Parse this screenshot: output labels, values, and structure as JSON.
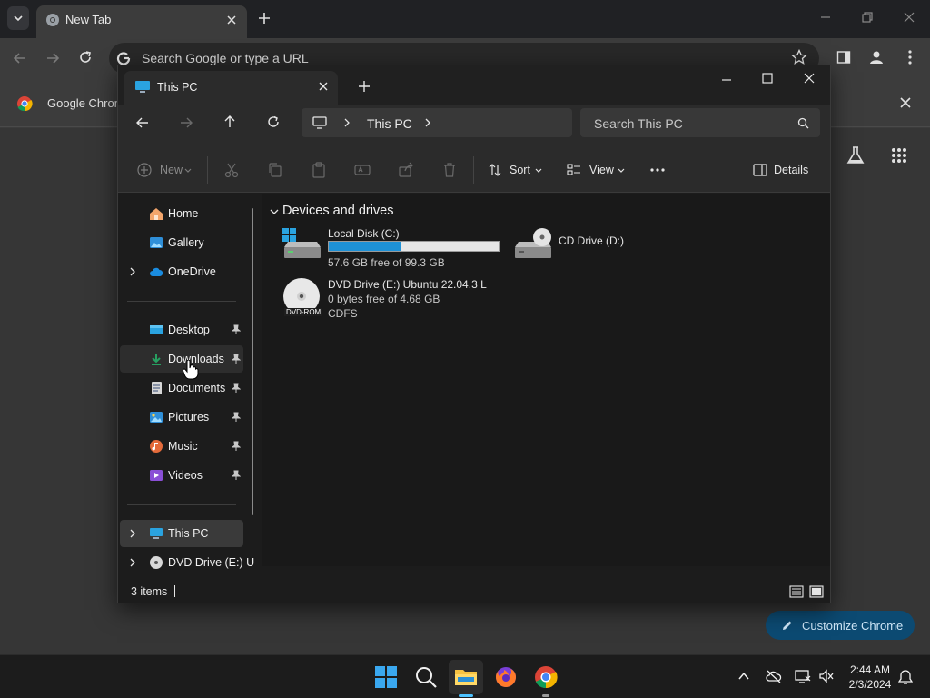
{
  "chrome": {
    "tab_title": "New Tab",
    "omnibox_placeholder": "Search Google or type a URL",
    "bookmark_label": "Google Chrome",
    "customize_label": "Customize Chrome"
  },
  "explorer": {
    "tab_title": "This PC",
    "breadcrumb": "This PC",
    "search_placeholder": "Search This PC",
    "commands": {
      "new": "New",
      "sort": "Sort",
      "view": "View",
      "details": "Details"
    },
    "sidebar": {
      "home": "Home",
      "gallery": "Gallery",
      "onedrive": "OneDrive",
      "desktop": "Desktop",
      "downloads": "Downloads",
      "documents": "Documents",
      "pictures": "Pictures",
      "music": "Music",
      "videos": "Videos",
      "this_pc": "This PC",
      "dvd_drive": "DVD Drive (E:) U"
    },
    "group_title": "Devices and drives",
    "drives": [
      {
        "name": "Local Disk (C:)",
        "free_text": "57.6 GB free of 99.3 GB",
        "used_fraction": 0.42
      },
      {
        "name": "CD Drive (D:)"
      },
      {
        "name": "DVD Drive (E:) Ubuntu 22.04.3 L",
        "free_text": "0 bytes free of 4.68 GB",
        "fs": "CDFS",
        "badge": "DVD-ROM"
      }
    ],
    "status": "3 items"
  },
  "taskbar": {
    "time": "2:44 AM",
    "date": "2/3/2024"
  },
  "colors": {
    "accent": "#1e91d6",
    "customize_bg": "#0c4a72",
    "taskbar_indicator": "#4cc2ff"
  }
}
